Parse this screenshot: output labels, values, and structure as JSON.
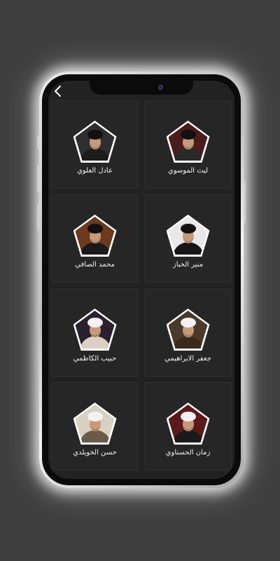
{
  "app": {
    "back_icon": "chevron-left-icon"
  },
  "colors": {
    "background": "#3f3f3f",
    "screen": "#222222",
    "card": "#262626",
    "text": "#f2f2f2"
  },
  "scholars": [
    {
      "name": "ليث الموسوي",
      "turban": "#111111",
      "robe": "#2a2a2a",
      "bg": "#4a1c1c"
    },
    {
      "name": "عادل العلوي",
      "turban": "#111111",
      "robe": "#1c1c1c",
      "bg": "#2f2f2f"
    },
    {
      "name": "منير الخباز",
      "turban": "#111111",
      "robe": "#151515",
      "bg": "#e8e8e8"
    },
    {
      "name": "محمد الصافي",
      "turban": "#111111",
      "robe": "#1a1a1a",
      "bg": "#6b3a1c"
    },
    {
      "name": "جعفر الابراهيمي",
      "turban": "#f2f2f2",
      "robe": "#3a2a1c",
      "bg": "#4a3a2c"
    },
    {
      "name": "حبيب الكاظمي",
      "turban": "#f2f2f2",
      "robe": "#d9d0c0",
      "bg": "#2a2030"
    },
    {
      "name": "زمان الحسناوي",
      "turban": "#f2f2f2",
      "robe": "#1a1a1a",
      "bg": "#5a1a1a"
    },
    {
      "name": "حسن الخويلدي",
      "turban": "#f2f2f2",
      "robe": "#6a5a4a",
      "bg": "#d8d0c0"
    }
  ]
}
